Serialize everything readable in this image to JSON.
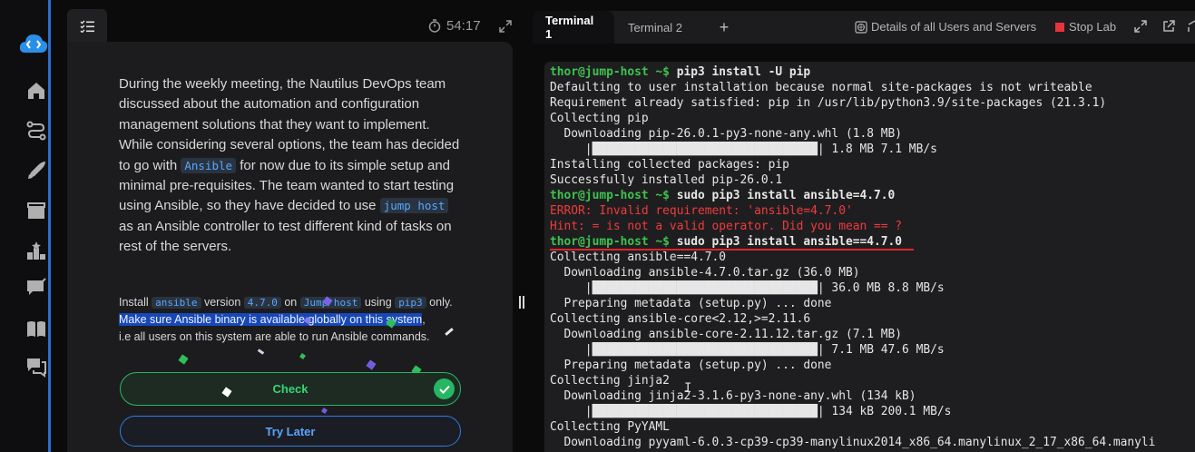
{
  "timer": "54:17",
  "task": {
    "desc_before_ansible": "During the weekly meeting, the Nautilus DevOps team discussed about the automation and configuration management solutions that they want to implement. While considering several options, the team has decided to go with ",
    "code_ansible": "Ansible",
    "desc_middle": " for now due to its simple setup and minimal pre-requisites. The team wanted to start testing using Ansible, so they have decided to use ",
    "code_jump_host": "jump host",
    "desc_end": " as an Ansible controller to test different kind of tasks on rest of the servers.",
    "instr_install": "Install ",
    "instr_code_ansible": "ansible",
    "instr_version": " version ",
    "instr_code_version": "4.7.0",
    "instr_on": " on ",
    "instr_code_jump": "Jump host",
    "instr_using": " using ",
    "instr_code_pip3": "pip3",
    "instr_only": " only.",
    "instr_highlight": "Make sure Ansible binary is available globally on this system",
    "instr_comma": ",",
    "instr_tail": "i.e all users on this system are able to run Ansible commands.",
    "check_label": "Check",
    "later_label": "Try Later"
  },
  "tabs": {
    "term1": "Terminal 1",
    "term2": "Terminal 2",
    "plus": "+",
    "details": "Details of all Users and Servers",
    "stop": "Stop Lab"
  },
  "terminal": {
    "l1_prompt": "thor@jump-host ~$",
    "l1_cmd": " pip3 install -U pip",
    "l2": "Defaulting to user installation because normal site-packages is not writeable",
    "l3": "Requirement already satisfied: pip in /usr/lib/python3.9/site-packages (21.3.1)",
    "l4": "Collecting pip",
    "l5": "  Downloading pip-26.0.1-py3-none-any.whl (1.8 MB)",
    "l6": "     |████████████████████████████████| 1.8 MB 7.1 MB/s",
    "l7": "Installing collected packages: pip",
    "l8": "Successfully installed pip-26.0.1",
    "l9_prompt": "thor@jump-host ~$",
    "l9_cmd": " sudo pip3 install ansible=4.7.0",
    "l10": "ERROR: Invalid requirement: 'ansible=4.7.0'",
    "l11": "Hint: = is not a valid operator. Did you mean == ?",
    "l12_prompt": "thor@jump-host ~$",
    "l12_cmd": " sudo pip3 install ansible==4.7.0",
    "l13": "Collecting ansible==4.7.0",
    "l14": "  Downloading ansible-4.7.0.tar.gz (36.0 MB)",
    "l15": "     |████████████████████████████████| 36.0 MB 8.8 MB/s",
    "l16": "  Preparing metadata (setup.py) ... done",
    "l17": "Collecting ansible-core<2.12,>=2.11.6",
    "l18": "  Downloading ansible-core-2.11.12.tar.gz (7.1 MB)",
    "l19": "     |████████████████████████████████| 7.1 MB 47.6 MB/s",
    "l20": "  Preparing metadata (setup.py) ... done",
    "l21": "Collecting jinja2",
    "l22": "  Downloading jinja2-3.1.6-py3-none-any.whl (134 kB)",
    "l23": "     |████████████████████████████████| 134 kB 200.1 MB/s",
    "l24": "Collecting PyYAML",
    "l25": "  Downloading pyyaml-6.0.3-cp39-cp39-manylinux2014_x86_64.manylinux_2_17_x86_64.manyli"
  },
  "colors": {
    "accent": "#2d6fd1",
    "prompt": "#3ec24f",
    "error": "#ef3b3b",
    "check": "#27b764",
    "stop": "#e8333d"
  }
}
